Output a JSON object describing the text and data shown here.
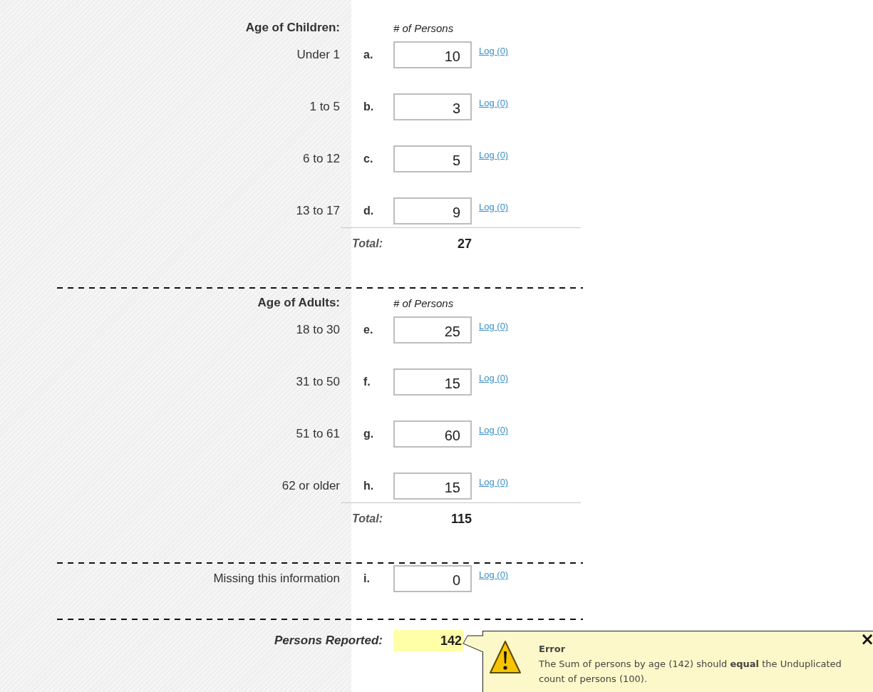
{
  "sections": [
    {
      "heading": "Age of Children:",
      "column_heading": "# of Persons",
      "rows": [
        {
          "label": "Under 1",
          "letter": "a.",
          "value": "10",
          "link": "Log (0)"
        },
        {
          "label": "1 to 5",
          "letter": "b.",
          "value": "3",
          "link": "Log (0)"
        },
        {
          "label": "6 to 12",
          "letter": "c.",
          "value": "5",
          "link": "Log (0)"
        },
        {
          "label": "13 to 17",
          "letter": "d.",
          "value": "9",
          "link": "Log (0)"
        }
      ],
      "total": {
        "label": "Total:",
        "value": "27"
      }
    },
    {
      "heading": "Age of Adults:",
      "column_heading": "# of Persons",
      "rows": [
        {
          "label": "18 to 30",
          "letter": "e.",
          "value": "25",
          "link": "Log (0)"
        },
        {
          "label": "31 to 50",
          "letter": "f.",
          "value": "15",
          "link": "Log (0)"
        },
        {
          "label": "51 to 61",
          "letter": "g.",
          "value": "60",
          "link": "Log (0)"
        },
        {
          "label": "62 or older",
          "letter": "h.",
          "value": "15",
          "link": "Log (0)"
        }
      ],
      "total": {
        "label": "Total:",
        "value": "115"
      }
    }
  ],
  "missing": {
    "label": "Missing this information",
    "letter": "i.",
    "value": "0",
    "link": "Log (0)"
  },
  "persons_reported": {
    "label": "Persons Reported:",
    "value": "142"
  },
  "error": {
    "title": "Error",
    "message": "The Sum of persons by age (142) should **equal** the Unduplicated count of persons (100).",
    "close": "×"
  }
}
